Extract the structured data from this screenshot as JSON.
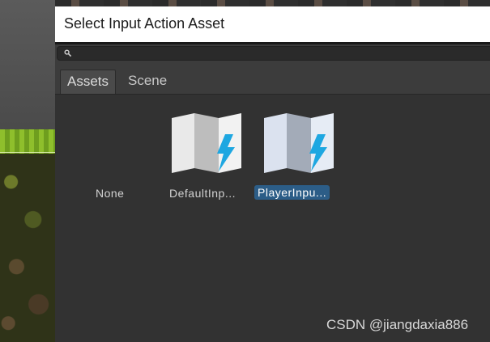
{
  "window": {
    "title": "Select Input Action Asset"
  },
  "search": {
    "value": ""
  },
  "tabs": [
    {
      "label": "Assets",
      "active": true
    },
    {
      "label": "Scene",
      "active": false
    }
  ],
  "assets": [
    {
      "label": "None",
      "selected": false,
      "icon": "none"
    },
    {
      "label": "DefaultInp...",
      "selected": false,
      "icon": "input-action-asset-icon"
    },
    {
      "label": "PlayerInpu...",
      "selected": true,
      "icon": "input-action-asset-icon"
    }
  ],
  "watermark": "CSDN @jiangdaxia886",
  "colors": {
    "selection": "#2c5d87",
    "lightning": "#1ea7e1",
    "window_bg": "#323232"
  }
}
